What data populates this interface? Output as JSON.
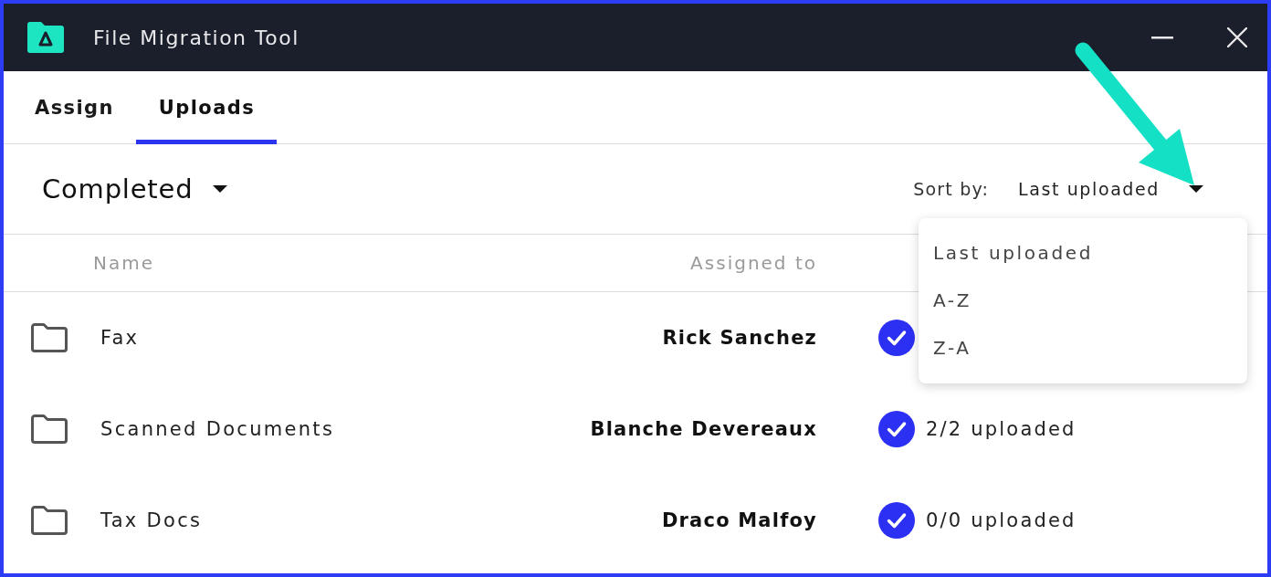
{
  "window": {
    "title": "File Migration Tool"
  },
  "tabs": [
    {
      "label": "Assign",
      "selected": false
    },
    {
      "label": "Uploads",
      "selected": true
    }
  ],
  "filter": {
    "value": "Completed"
  },
  "sort": {
    "label": "Sort by:",
    "value": "Last uploaded",
    "expanded": true,
    "options": [
      "Last uploaded",
      "A-Z",
      "Z-A"
    ]
  },
  "table": {
    "columns": [
      "Name",
      "Assigned to"
    ],
    "rows": [
      {
        "name": "Fax",
        "assigned_to": "Rick Sanchez",
        "done": true
      },
      {
        "name": "Scanned Documents",
        "assigned_to": "Blanche Devereaux",
        "done": true,
        "status": "2/2 uploaded"
      },
      {
        "name": "Tax Docs",
        "assigned_to": "Draco Malfoy",
        "done": true,
        "status": "0/0 uploaded"
      }
    ]
  }
}
